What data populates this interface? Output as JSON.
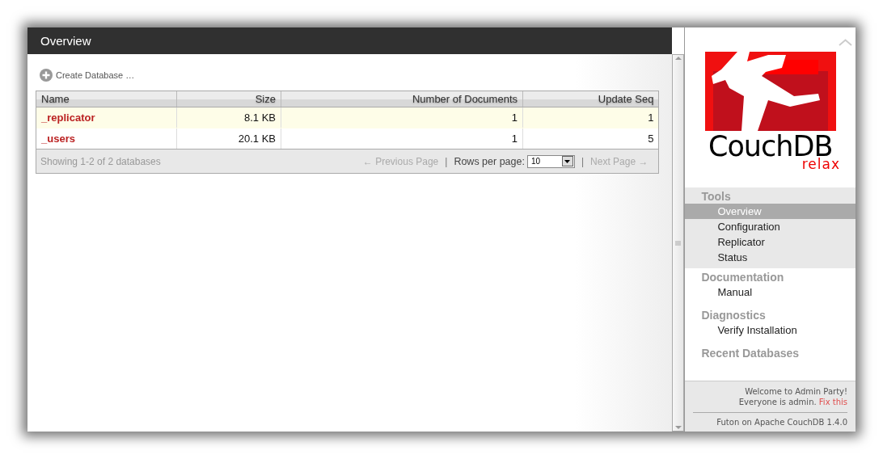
{
  "window": {
    "title": "Overview"
  },
  "toolbar": {
    "create_button": "Create Database …"
  },
  "table": {
    "columns": [
      "Name",
      "Size",
      "Number of Documents",
      "Update Seq"
    ],
    "rows": [
      [
        "_replicator",
        "8.1 KB",
        "1",
        "1"
      ],
      [
        "_users",
        "20.1 KB",
        "1",
        "5"
      ]
    ],
    "footer": {
      "summary": "Showing 1-2 of 2 databases",
      "previous": "← Previous Page",
      "separator_1": "|",
      "rows_label": "Rows per page:",
      "rows_value": "10",
      "separator_2": "|",
      "next": "Next Page →"
    }
  },
  "sidebar": {
    "logo": {
      "name": "CouchDB",
      "tagline": "relax"
    },
    "sections": [
      {
        "title": "Tools",
        "items": [
          {
            "label": "Overview",
            "selected": true
          },
          {
            "label": "Configuration",
            "selected": false
          },
          {
            "label": "Replicator",
            "selected": false
          },
          {
            "label": "Status",
            "selected": false
          }
        ]
      },
      {
        "title": "Documentation",
        "items": [
          {
            "label": "Manual",
            "selected": false
          }
        ]
      },
      {
        "title": "Diagnostics",
        "items": [
          {
            "label": "Verify Installation",
            "selected": false
          }
        ]
      },
      {
        "title": "Recent Databases"
      }
    ],
    "footer": {
      "welcome": "Welcome to Admin Party!",
      "message": "Everyone is admin.",
      "link": "Fix this",
      "version": "Futon on Apache CouchDB 1.4.0"
    }
  }
}
